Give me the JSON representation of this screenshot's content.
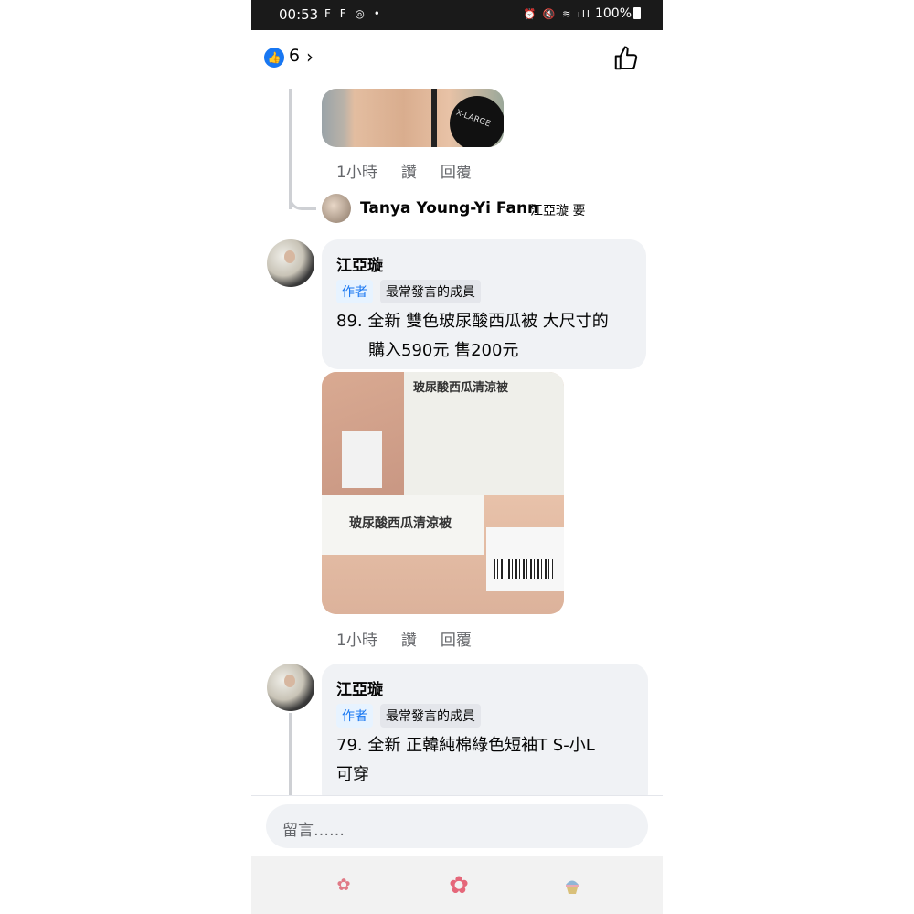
{
  "status_bar": {
    "time": "00:53",
    "left_icons": "F F ◎ •",
    "right_text": "100%"
  },
  "header": {
    "like_count": "6",
    "like_color": "#1877f2"
  },
  "comments": [
    {
      "time": "1小時",
      "like_label": "讚",
      "reply_label": "回覆"
    },
    {
      "reply_preview_name": "Tanya Young-Yi Fann",
      "reply_preview_text": "江亞璇 要"
    },
    {
      "author": "江亞璇",
      "badge_author": "作者",
      "badge_member": "最常發言的成員",
      "text_line1": "89. 全新 雙色玻尿酸西瓜被 大尺寸的",
      "text_line2": "購入590元  售200元",
      "photo_text_top": "玻尿酸西瓜清涼被",
      "photo_text_bottom": "玻尿酸西瓜清涼被",
      "time": "1小時",
      "like_label": "讚",
      "reply_label": "回覆"
    },
    {
      "author": "江亞璇",
      "badge_author": "作者",
      "badge_member": "最常發言的成員",
      "text_line1": "79. 全新 正韓純棉綠色短袖T S-小L",
      "text_line2": "可穿"
    }
  ],
  "photo1_label": "X-LARGE",
  "composer": {
    "placeholder": "留言……"
  },
  "nav_icons": [
    "small-flower-icon",
    "flower-icon",
    "cupcake-icon"
  ]
}
